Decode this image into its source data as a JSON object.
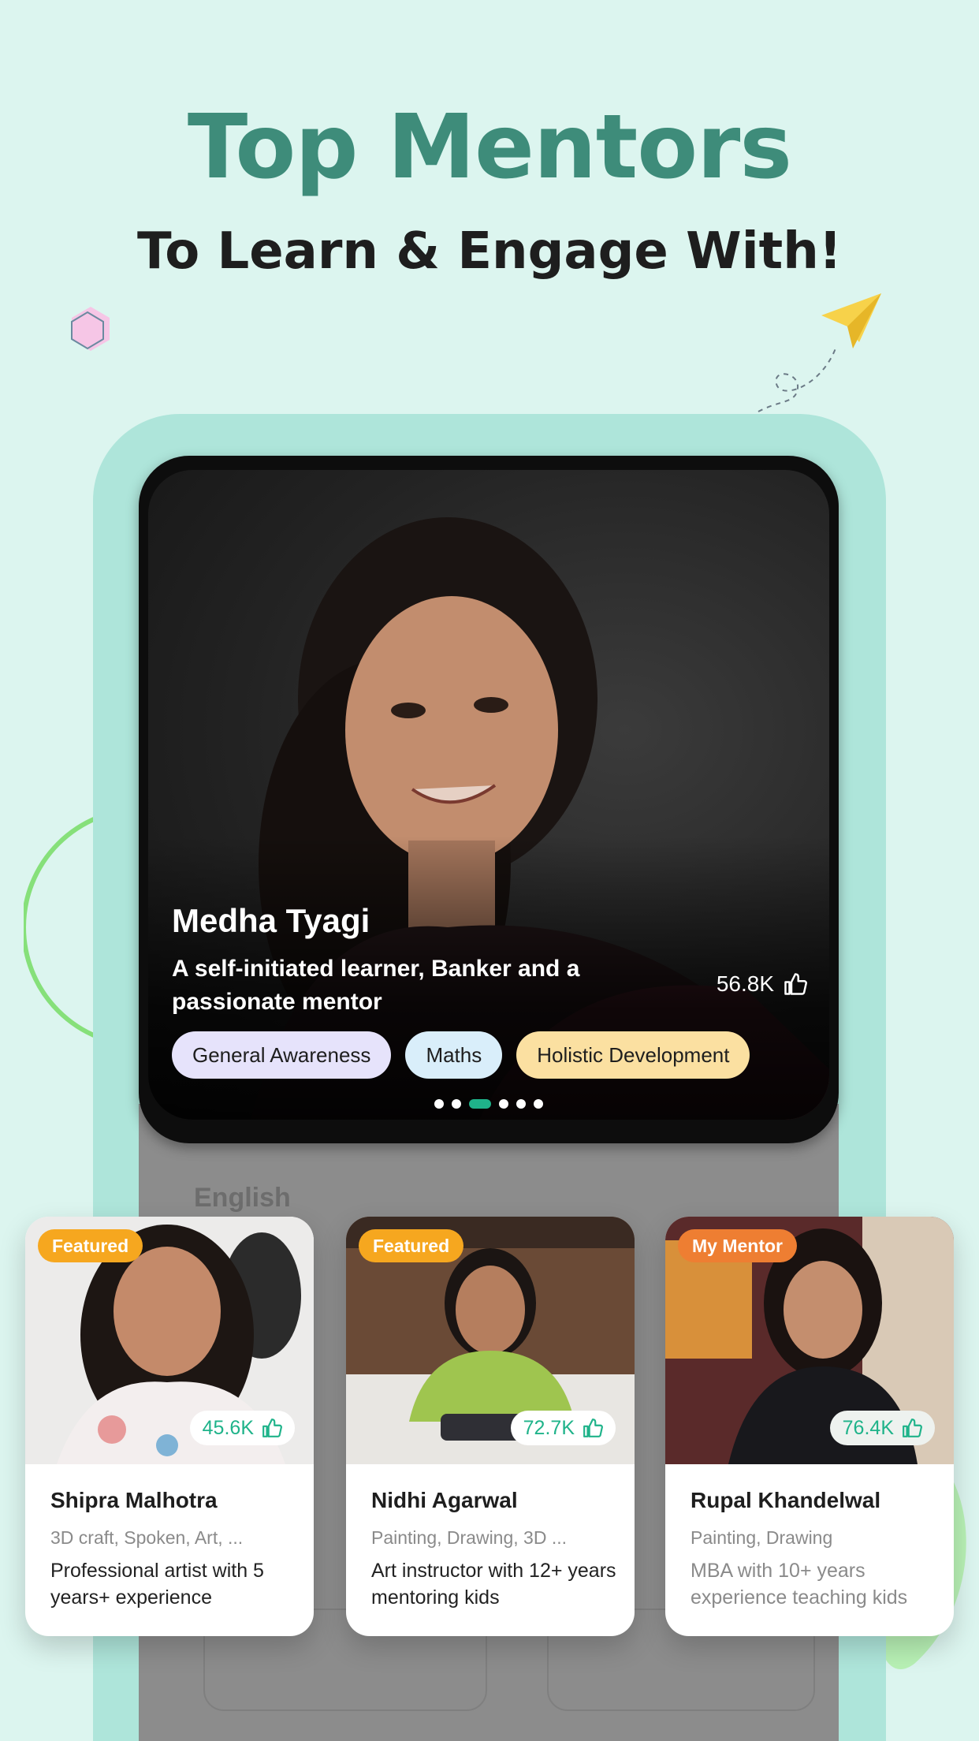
{
  "header": {
    "title": "Top Mentors",
    "subtitle": "To Learn & Engage With!"
  },
  "hero": {
    "name": "Medha Tyagi",
    "description": "A self-initiated learner, Banker and a passionate mentor",
    "likes": "56.8K",
    "chips": [
      {
        "label": "General Awareness",
        "color": "#e6e3fb"
      },
      {
        "label": "Maths",
        "color": "#d9eefa"
      },
      {
        "label": "Holistic Development",
        "color": "#fbe0a1"
      }
    ],
    "carousel": {
      "count": 6,
      "active_index": 2
    }
  },
  "background_screen": {
    "section_label": "English"
  },
  "cards": [
    {
      "badge": "Featured",
      "badge_color": "#f6a71f",
      "likes": "45.6K",
      "name": "Shipra Malhotra",
      "tags": "3D craft, Spoken, Art, ...",
      "bio": "Professional artist with 5 years+ experience"
    },
    {
      "badge": "Featured",
      "badge_color": "#f6a71f",
      "likes": "72.7K",
      "name": "Nidhi Agarwal",
      "tags": "Painting, Drawing, 3D ...",
      "bio": "Art instructor with 12+ years mentoring kids"
    },
    {
      "badge": "My Mentor",
      "badge_color": "#ee7e32",
      "likes": "76.4K",
      "name": "Rupal Khandelwal",
      "tags": "Painting, Drawing",
      "bio": "MBA with 10+ years experience teaching kids"
    }
  ],
  "colors": {
    "background": "#dcf5ef",
    "heading": "#3e8c7a",
    "accent": "#1fb38a",
    "frame": "#aee5da"
  }
}
